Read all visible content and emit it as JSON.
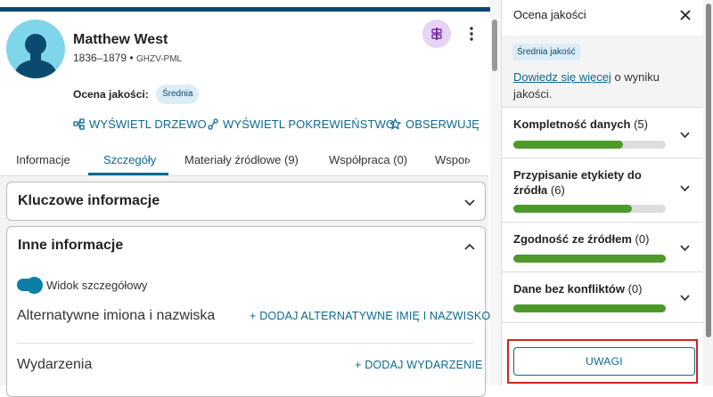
{
  "person": {
    "name": "Matthew West",
    "lifespan": "1836–1879",
    "separator": "•",
    "id": "GHZV-PML",
    "quality_label": "Ocena jakości:",
    "quality_value": "Średnia"
  },
  "actions": {
    "view_tree": "WYŚWIETL DRZEWO",
    "view_relationship": "WYŚWIETL POKREWIEŃSTWO",
    "watch": "OBSERWUJĘ"
  },
  "tabs": [
    {
      "label": "Informacje"
    },
    {
      "label": "Szczegóły",
      "active": true
    },
    {
      "label": "Materiały źródłowe (9)"
    },
    {
      "label": "Współpraca (0)"
    },
    {
      "label": "Wspom"
    }
  ],
  "sections": {
    "key_info": "Kluczowe informacje",
    "other_info": "Inne informacje",
    "detailed_view_label": "Widok szczegółowy",
    "detailed_view_on": true,
    "alt_names_label": "Alternatywne imiona i nazwiska",
    "alt_names_add": "DODAJ ALTERNATYWNE IMIĘ I NAZWISKO",
    "events_label": "Wydarzenia",
    "events_add": "DODAJ WYDARZENIE"
  },
  "quality_panel": {
    "title": "Ocena jakości",
    "badge": "Średnia jakość",
    "learn_more_link": "Dowiedz się więcej",
    "learn_more_rest": " o wyniku jakości.",
    "metrics": [
      {
        "label": "Kompletność danych",
        "count": "(5)",
        "fill": 0.72
      },
      {
        "label": "Przypisanie etykiety do źródła",
        "count": "(6)",
        "fill": 0.78
      },
      {
        "label": "Zgodność ze źródłem",
        "count": "(0)",
        "fill": 1.0
      },
      {
        "label": "Dane bez konfliktów",
        "count": "(0)",
        "fill": 1.0
      }
    ],
    "notes_button": "UWAGI"
  },
  "colors": {
    "accent": "#0b6a8f",
    "progress": "#4d9a2a",
    "highlight": "#d9201d"
  }
}
